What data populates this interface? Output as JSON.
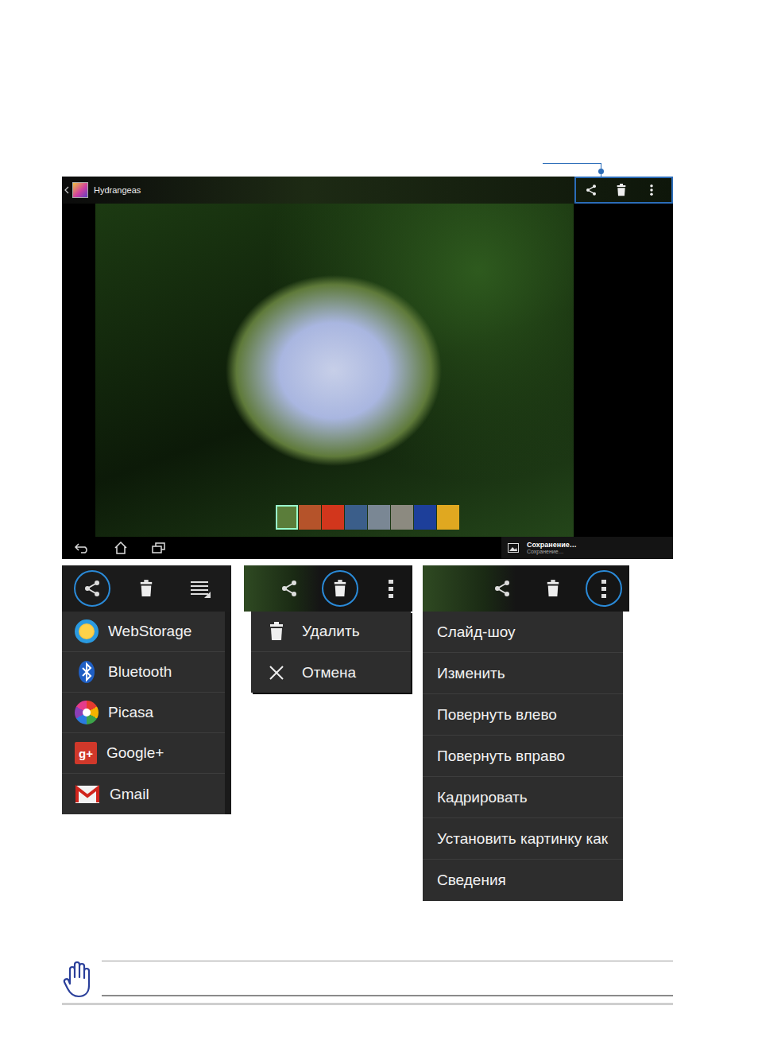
{
  "viewer": {
    "title": "Hydrangeas",
    "actionsHighlighted": true,
    "actions": [
      {
        "kind": "share"
      },
      {
        "kind": "delete"
      },
      {
        "kind": "more"
      }
    ],
    "thumbnails": [
      {
        "color": "#5b7d3a",
        "selected": true
      },
      {
        "color": "#b5532a",
        "selected": false
      },
      {
        "color": "#d2361c",
        "selected": false
      },
      {
        "color": "#3b5e8a",
        "selected": false
      },
      {
        "color": "#7a8794",
        "selected": false
      },
      {
        "color": "#8c8a80",
        "selected": false
      },
      {
        "color": "#1d3f9a",
        "selected": false
      },
      {
        "color": "#e0a820",
        "selected": false
      }
    ],
    "notification": {
      "title": "Сохранение…",
      "subtitle": "Сохранение…"
    }
  },
  "menus": [
    {
      "actions": [
        {
          "kind": "share",
          "circled": true
        },
        {
          "kind": "delete",
          "circled": false
        },
        {
          "kind": "list",
          "circled": false
        }
      ],
      "items": [
        {
          "label": "WebStorage",
          "kind": "webstorage"
        },
        {
          "label": "Bluetooth",
          "kind": "bluetooth"
        },
        {
          "label": "Picasa",
          "kind": "picasa"
        },
        {
          "label": "Google+",
          "kind": "googleplus",
          "badge": "g+"
        },
        {
          "label": "Gmail",
          "kind": "gmail"
        }
      ]
    },
    {
      "actions": [
        {
          "kind": "share",
          "circled": false
        },
        {
          "kind": "delete",
          "circled": true
        },
        {
          "kind": "more",
          "circled": false
        }
      ],
      "items": [
        {
          "label": "Удалить",
          "kind": "delete"
        },
        {
          "label": "Отмена",
          "kind": "cancel"
        }
      ]
    },
    {
      "actions": [
        {
          "kind": "share",
          "circled": false
        },
        {
          "kind": "delete",
          "circled": false
        },
        {
          "kind": "more",
          "circled": true
        }
      ],
      "items": [
        {
          "label": "Слайд-шоу",
          "kind": "text"
        },
        {
          "label": "Изменить",
          "kind": "text"
        },
        {
          "label": "Повернуть влево",
          "kind": "text"
        },
        {
          "label": "Повернуть вправо",
          "kind": "text"
        },
        {
          "label": "Кадрировать",
          "kind": "text"
        },
        {
          "label": "Установить картинку как",
          "kind": "text"
        },
        {
          "label": "Сведения",
          "kind": "text"
        }
      ]
    }
  ]
}
